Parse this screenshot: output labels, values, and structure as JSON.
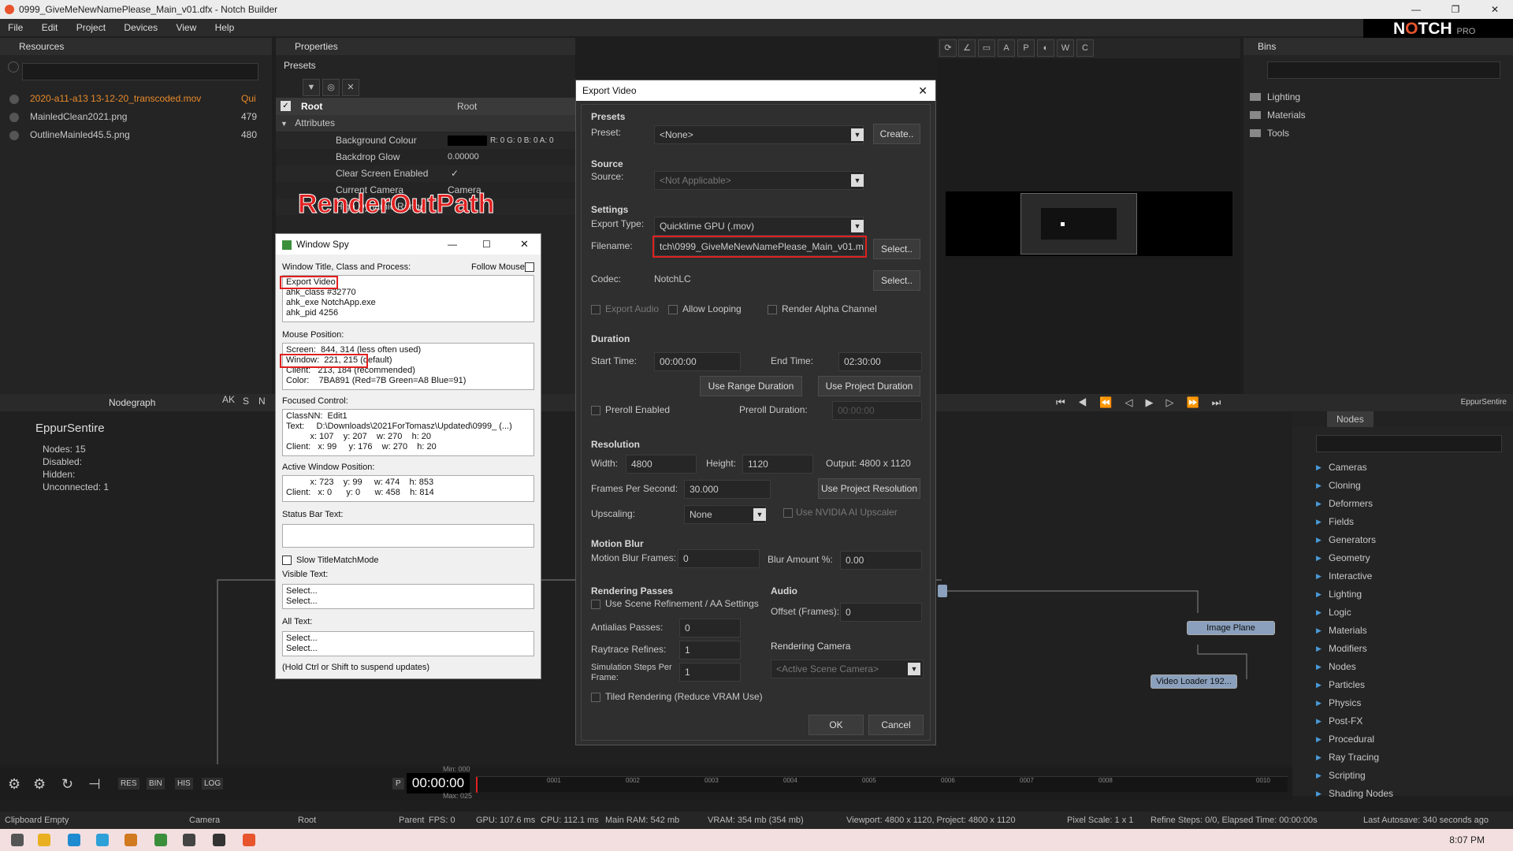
{
  "window": {
    "title": "0999_GiveMeNewNamePlease_Main_v01.dfx - Notch Builder",
    "brand": "N",
    "brand_o": "O",
    "brand_tch": "TCH",
    "brand_pro": "PRO",
    "controls": {
      "minimize": "—",
      "maximize": "❐",
      "close": "✕"
    }
  },
  "menu": [
    "File",
    "Edit",
    "Project",
    "Devices",
    "View",
    "Help"
  ],
  "resources": {
    "title": "Resources",
    "items": [
      {
        "name": "2020-a11-a13 13-12-20_transcoded.mov",
        "size": "Qui",
        "highlight": true
      },
      {
        "name": "MainledClean2021.png",
        "size": "479",
        "highlight": false
      },
      {
        "name": "OutlineMainled45.5.png",
        "size": "480",
        "highlight": false
      }
    ]
  },
  "properties": {
    "title": "Properties",
    "presets": "Presets",
    "root_label": "Root",
    "root_value": "Root",
    "attributes": "Attributes",
    "rows": [
      {
        "label": "Background Colour",
        "value": "R: 0 G: 0 B: 0 A: 0"
      },
      {
        "label": "Backdrop Glow",
        "value": "0.00000"
      },
      {
        "label": "Clear Screen Enabled",
        "value": "✓"
      },
      {
        "label": "Current Camera",
        "value": "Camera"
      },
      {
        "label": "High Dynamic Range",
        "value": ""
      }
    ]
  },
  "annotation": "RenderOutPath",
  "bins": {
    "title": "Bins",
    "items": [
      "Lighting",
      "Materials",
      "Tools"
    ]
  },
  "nodegraph": {
    "title": "Nodegraph",
    "toolbar": [
      "AK",
      "S",
      "N"
    ],
    "name": "EppurSentire",
    "stats": [
      {
        "label": "Nodes:",
        "value": "15"
      },
      {
        "label": "Disabled:",
        "value": ""
      },
      {
        "label": "Hidden:",
        "value": ""
      },
      {
        "label": "Unconnected:",
        "value": "1"
      }
    ],
    "nodes": {
      "image_plane": "Image Plane",
      "video_loader": "Video Loader 192..."
    }
  },
  "nodes_panel": {
    "tab": "Nodes",
    "tab2": "EppurSentire",
    "items": [
      "Cameras",
      "Cloning",
      "Deformers",
      "Fields",
      "Generators",
      "Geometry",
      "Interactive",
      "Lighting",
      "Logic",
      "Materials",
      "Modifiers",
      "Nodes",
      "Particles",
      "Physics",
      "Post-FX",
      "Procedural",
      "Ray Tracing",
      "Scripting",
      "Shading Nodes"
    ]
  },
  "export": {
    "title": "Export Video",
    "presets_h": "Presets",
    "preset_l": "Preset:",
    "preset_v": "<None>",
    "create": "Create..",
    "source_h": "Source",
    "source_l": "Source:",
    "source_v": "<Not Applicable>",
    "settings_h": "Settings",
    "type_l": "Export Type:",
    "type_v": "Quicktime GPU (.mov)",
    "file_l": "Filename:",
    "file_v": "tch\\0999_GiveMeNewNamePlease_Main_v01.mov",
    "select": "Select..",
    "codec_l": "Codec:",
    "codec_v": "NotchLC",
    "export_audio": "Export Audio",
    "allow_looping": "Allow Looping",
    "render_alpha": "Render Alpha Channel",
    "duration_h": "Duration",
    "start_l": "Start Time:",
    "start_v": "00:00:00",
    "end_l": "End Time:",
    "end_v": "02:30:00",
    "use_range": "Use Range Duration",
    "use_project": "Use Project Duration",
    "preroll": "Preroll Enabled",
    "preroll_d": "Preroll Duration:",
    "preroll_v": "00:00:00",
    "res_h": "Resolution",
    "width_l": "Width:",
    "width_v": "4800",
    "height_l": "Height:",
    "height_v": "1120",
    "output": "Output: 4800 x 1120",
    "fps_l": "Frames Per Second:",
    "fps_v": "30.000",
    "use_proj_res": "Use Project Resolution",
    "upscale_l": "Upscaling:",
    "upscale_v": "None",
    "nvidia": "Use NVIDIA AI Upscaler",
    "mb_h": "Motion Blur",
    "mbf_l": "Motion Blur Frames:",
    "mbf_v": "0",
    "blur_l": "Blur Amount %:",
    "blur_v": "0.00",
    "rp_h": "Rendering Passes",
    "scene_ref": "Use Scene Refinement / AA Settings",
    "aa_l": "Antialias Passes:",
    "aa_v": "0",
    "rt_l": "Raytrace Refines:",
    "rt_v": "1",
    "sim_l": "Simulation Steps Per Frame:",
    "sim_v": "1",
    "tiled": "Tiled Rendering (Reduce VRAM Use)",
    "audio_h": "Audio",
    "offset_l": "Offset (Frames):",
    "offset_v": "0",
    "cam_h": "Rendering Camera",
    "cam_v": "<Active Scene Camera>",
    "ok": "OK",
    "cancel": "Cancel"
  },
  "spy": {
    "title": "Window Spy",
    "wtcp": "Window Title, Class and Process:",
    "follow": "Follow Mouse",
    "box1": "Export Video\nahk_class #32770\nahk_exe NotchApp.exe\nahk_pid 4256",
    "mouse": "Mouse Position:",
    "box2": "Screen:  844, 314 (less often used)\nWindow:  221, 215 (default)\nClient:   213, 184 (recommended)\nColor:    7BA891 (Red=7B Green=A8 Blue=91)",
    "focused": "Focused Control:",
    "box3": "ClassNN:  Edit1\nText:     D:\\Downloads\\2021ForTomasz\\Updated\\0999_ (...)\n          x: 107    y: 207    w: 270    h: 20\nClient:   x: 99     y: 176    w: 270    h: 20",
    "active": "Active Window Position:",
    "box4": "          x: 723    y: 99     w: 474    h: 853\nClient:   x: 0      y: 0      w: 458    h: 814",
    "status": "Status Bar Text:",
    "slow": "Slow TitleMatchMode",
    "visible": "Visible Text:",
    "box5": "Select...\nSelect...",
    "alltext": "All Text:",
    "box6": "Select...\nSelect...",
    "hold": "(Hold Ctrl or Shift to suspend updates)"
  },
  "timeline": {
    "time": "00:00:00",
    "p": "P",
    "min": "Min: 000",
    "max": "Max: 025",
    "buttons": [
      "RES",
      "BIN",
      "HIS",
      "LOG"
    ],
    "ticks": [
      "0001",
      "0002",
      "0003",
      "0004",
      "0005",
      "0006",
      "0007",
      "0008",
      "0010"
    ]
  },
  "statusbar": {
    "clipboard": "Clipboard Empty",
    "camera": "Camera",
    "root": "Root",
    "parent": "Parent",
    "fps": "FPS: 0",
    "gpu": "GPU: 107.6 ms",
    "cpu": "CPU: 112.1 ms",
    "ram": "Main RAM: 542 mb",
    "vram": "VRAM: 354 mb (354 mb)",
    "viewport": "Viewport: 4800 x 1120, Project: 4800 x 1120",
    "pixel": "Pixel Scale: 1 x 1",
    "refine": "Refine Steps: 0/0, Elapsed Time: 00:00:00s",
    "autosave": "Last Autosave: 340 seconds ago"
  },
  "taskbar": {
    "time": "8:07 PM"
  }
}
